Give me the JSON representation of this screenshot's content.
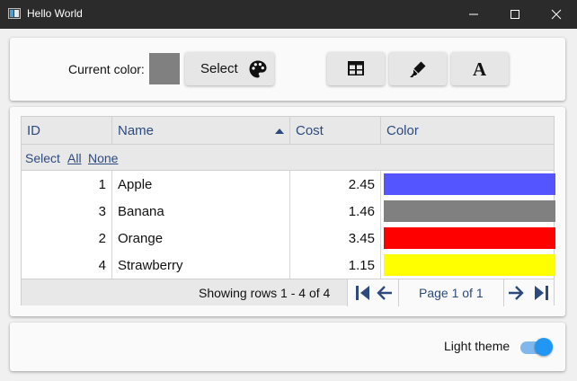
{
  "window": {
    "title": "Hello World"
  },
  "toolbar": {
    "current_color_label": "Current color:",
    "current_color": "#808080",
    "select_label": "Select",
    "font_glyph": "A"
  },
  "grid": {
    "columns": [
      {
        "label": "ID"
      },
      {
        "label": "Name",
        "sort": "ascending"
      },
      {
        "label": "Cost"
      },
      {
        "label": "Color"
      }
    ],
    "select_row": {
      "label": "Select",
      "all": "All",
      "none": "None"
    },
    "rows": [
      {
        "id": "1",
        "name": "Apple",
        "cost": "2.45",
        "color": "#5555ff"
      },
      {
        "id": "3",
        "name": "Banana",
        "cost": "1.46",
        "color": "#808080"
      },
      {
        "id": "2",
        "name": "Orange",
        "cost": "3.45",
        "color": "#ff0000"
      },
      {
        "id": "4",
        "name": "Strawberry",
        "cost": "1.15",
        "color": "#ffff00"
      }
    ],
    "footer": {
      "rows_info": "Showing rows 1 - 4 of 4",
      "page_label": "Page 1 of 1"
    }
  },
  "settings": {
    "theme_label": "Light theme",
    "theme_on": true
  },
  "colors": {
    "header_text": "#2d4a7e",
    "accent": "#2196f3",
    "titlebar": "#2b2b2b"
  }
}
